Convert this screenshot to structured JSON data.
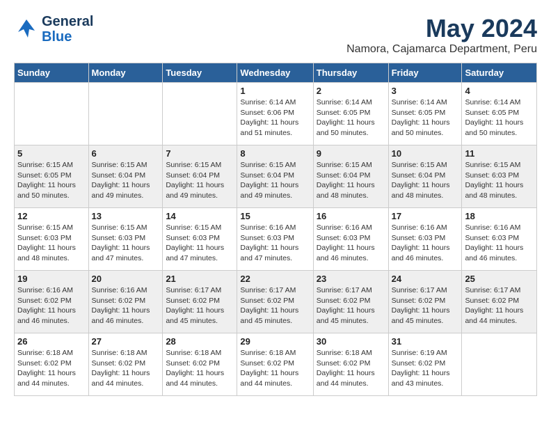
{
  "header": {
    "logo_line1": "General",
    "logo_line2": "Blue",
    "month": "May 2024",
    "location": "Namora, Cajamarca Department, Peru"
  },
  "columns": [
    "Sunday",
    "Monday",
    "Tuesday",
    "Wednesday",
    "Thursday",
    "Friday",
    "Saturday"
  ],
  "weeks": [
    {
      "days": [
        {
          "number": "",
          "info": ""
        },
        {
          "number": "",
          "info": ""
        },
        {
          "number": "",
          "info": ""
        },
        {
          "number": "1",
          "info": "Sunrise: 6:14 AM\nSunset: 6:06 PM\nDaylight: 11 hours\nand 51 minutes."
        },
        {
          "number": "2",
          "info": "Sunrise: 6:14 AM\nSunset: 6:05 PM\nDaylight: 11 hours\nand 50 minutes."
        },
        {
          "number": "3",
          "info": "Sunrise: 6:14 AM\nSunset: 6:05 PM\nDaylight: 11 hours\nand 50 minutes."
        },
        {
          "number": "4",
          "info": "Sunrise: 6:14 AM\nSunset: 6:05 PM\nDaylight: 11 hours\nand 50 minutes."
        }
      ]
    },
    {
      "days": [
        {
          "number": "5",
          "info": "Sunrise: 6:15 AM\nSunset: 6:05 PM\nDaylight: 11 hours\nand 50 minutes."
        },
        {
          "number": "6",
          "info": "Sunrise: 6:15 AM\nSunset: 6:04 PM\nDaylight: 11 hours\nand 49 minutes."
        },
        {
          "number": "7",
          "info": "Sunrise: 6:15 AM\nSunset: 6:04 PM\nDaylight: 11 hours\nand 49 minutes."
        },
        {
          "number": "8",
          "info": "Sunrise: 6:15 AM\nSunset: 6:04 PM\nDaylight: 11 hours\nand 49 minutes."
        },
        {
          "number": "9",
          "info": "Sunrise: 6:15 AM\nSunset: 6:04 PM\nDaylight: 11 hours\nand 48 minutes."
        },
        {
          "number": "10",
          "info": "Sunrise: 6:15 AM\nSunset: 6:04 PM\nDaylight: 11 hours\nand 48 minutes."
        },
        {
          "number": "11",
          "info": "Sunrise: 6:15 AM\nSunset: 6:03 PM\nDaylight: 11 hours\nand 48 minutes."
        }
      ]
    },
    {
      "days": [
        {
          "number": "12",
          "info": "Sunrise: 6:15 AM\nSunset: 6:03 PM\nDaylight: 11 hours\nand 48 minutes."
        },
        {
          "number": "13",
          "info": "Sunrise: 6:15 AM\nSunset: 6:03 PM\nDaylight: 11 hours\nand 47 minutes."
        },
        {
          "number": "14",
          "info": "Sunrise: 6:15 AM\nSunset: 6:03 PM\nDaylight: 11 hours\nand 47 minutes."
        },
        {
          "number": "15",
          "info": "Sunrise: 6:16 AM\nSunset: 6:03 PM\nDaylight: 11 hours\nand 47 minutes."
        },
        {
          "number": "16",
          "info": "Sunrise: 6:16 AM\nSunset: 6:03 PM\nDaylight: 11 hours\nand 46 minutes."
        },
        {
          "number": "17",
          "info": "Sunrise: 6:16 AM\nSunset: 6:03 PM\nDaylight: 11 hours\nand 46 minutes."
        },
        {
          "number": "18",
          "info": "Sunrise: 6:16 AM\nSunset: 6:03 PM\nDaylight: 11 hours\nand 46 minutes."
        }
      ]
    },
    {
      "days": [
        {
          "number": "19",
          "info": "Sunrise: 6:16 AM\nSunset: 6:02 PM\nDaylight: 11 hours\nand 46 minutes."
        },
        {
          "number": "20",
          "info": "Sunrise: 6:16 AM\nSunset: 6:02 PM\nDaylight: 11 hours\nand 46 minutes."
        },
        {
          "number": "21",
          "info": "Sunrise: 6:17 AM\nSunset: 6:02 PM\nDaylight: 11 hours\nand 45 minutes."
        },
        {
          "number": "22",
          "info": "Sunrise: 6:17 AM\nSunset: 6:02 PM\nDaylight: 11 hours\nand 45 minutes."
        },
        {
          "number": "23",
          "info": "Sunrise: 6:17 AM\nSunset: 6:02 PM\nDaylight: 11 hours\nand 45 minutes."
        },
        {
          "number": "24",
          "info": "Sunrise: 6:17 AM\nSunset: 6:02 PM\nDaylight: 11 hours\nand 45 minutes."
        },
        {
          "number": "25",
          "info": "Sunrise: 6:17 AM\nSunset: 6:02 PM\nDaylight: 11 hours\nand 44 minutes."
        }
      ]
    },
    {
      "days": [
        {
          "number": "26",
          "info": "Sunrise: 6:18 AM\nSunset: 6:02 PM\nDaylight: 11 hours\nand 44 minutes."
        },
        {
          "number": "27",
          "info": "Sunrise: 6:18 AM\nSunset: 6:02 PM\nDaylight: 11 hours\nand 44 minutes."
        },
        {
          "number": "28",
          "info": "Sunrise: 6:18 AM\nSunset: 6:02 PM\nDaylight: 11 hours\nand 44 minutes."
        },
        {
          "number": "29",
          "info": "Sunrise: 6:18 AM\nSunset: 6:02 PM\nDaylight: 11 hours\nand 44 minutes."
        },
        {
          "number": "30",
          "info": "Sunrise: 6:18 AM\nSunset: 6:02 PM\nDaylight: 11 hours\nand 44 minutes."
        },
        {
          "number": "31",
          "info": "Sunrise: 6:19 AM\nSunset: 6:02 PM\nDaylight: 11 hours\nand 43 minutes."
        },
        {
          "number": "",
          "info": ""
        }
      ]
    }
  ]
}
